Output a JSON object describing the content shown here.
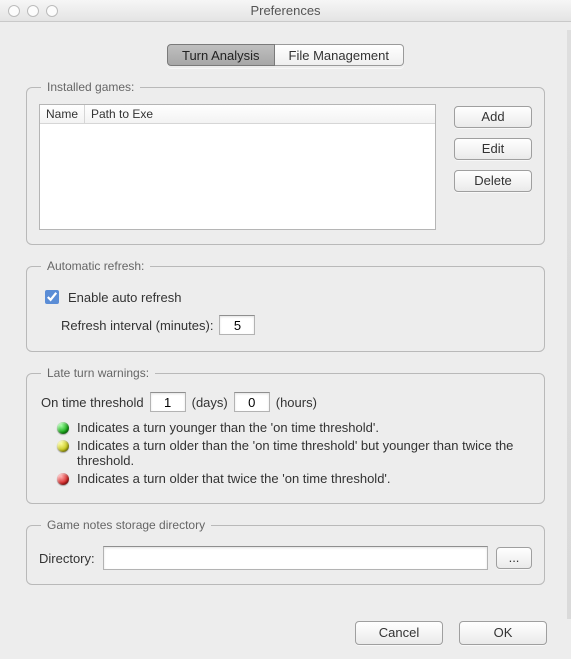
{
  "window": {
    "title": "Preferences"
  },
  "tabs": {
    "turn_analysis": "Turn Analysis",
    "file_management": "File Management"
  },
  "groups": {
    "installed_games": "Installed games:",
    "automatic_refresh": "Automatic refresh:",
    "late_turn_warnings": "Late turn warnings:",
    "notes_dir": "Game notes storage directory"
  },
  "table": {
    "col_name": "Name",
    "col_path": "Path to Exe"
  },
  "buttons": {
    "add": "Add",
    "edit": "Edit",
    "delete": "Delete",
    "browse": "...",
    "cancel": "Cancel",
    "ok": "OK"
  },
  "auto_refresh": {
    "enable_label": "Enable auto refresh",
    "enabled": true,
    "interval_label": "Refresh interval (minutes):",
    "interval_value": "5"
  },
  "late_warnings": {
    "threshold_label": "On time threshold",
    "days_value": "1",
    "days_label": "(days)",
    "hours_value": "0",
    "hours_label": "(hours)",
    "legend_green": "Indicates a turn younger than the 'on time threshold'.",
    "legend_yellow": "Indicates a turn older than the 'on time threshold' but younger than twice the threshold.",
    "legend_red": "Indicates a turn older that twice the 'on time threshold'."
  },
  "notes": {
    "label": "Directory:",
    "value": ""
  }
}
